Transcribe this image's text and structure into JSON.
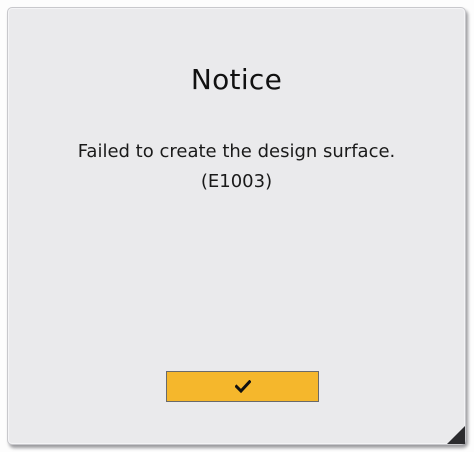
{
  "dialog": {
    "title": "Notice",
    "message_line1": "Failed to create the design surface.",
    "message_line2": "(E1003)",
    "confirm_button": {
      "icon": "check-icon"
    }
  },
  "colors": {
    "dialog_background": "#eaeaec",
    "button_background": "#f5b72c",
    "text": "#111111"
  }
}
